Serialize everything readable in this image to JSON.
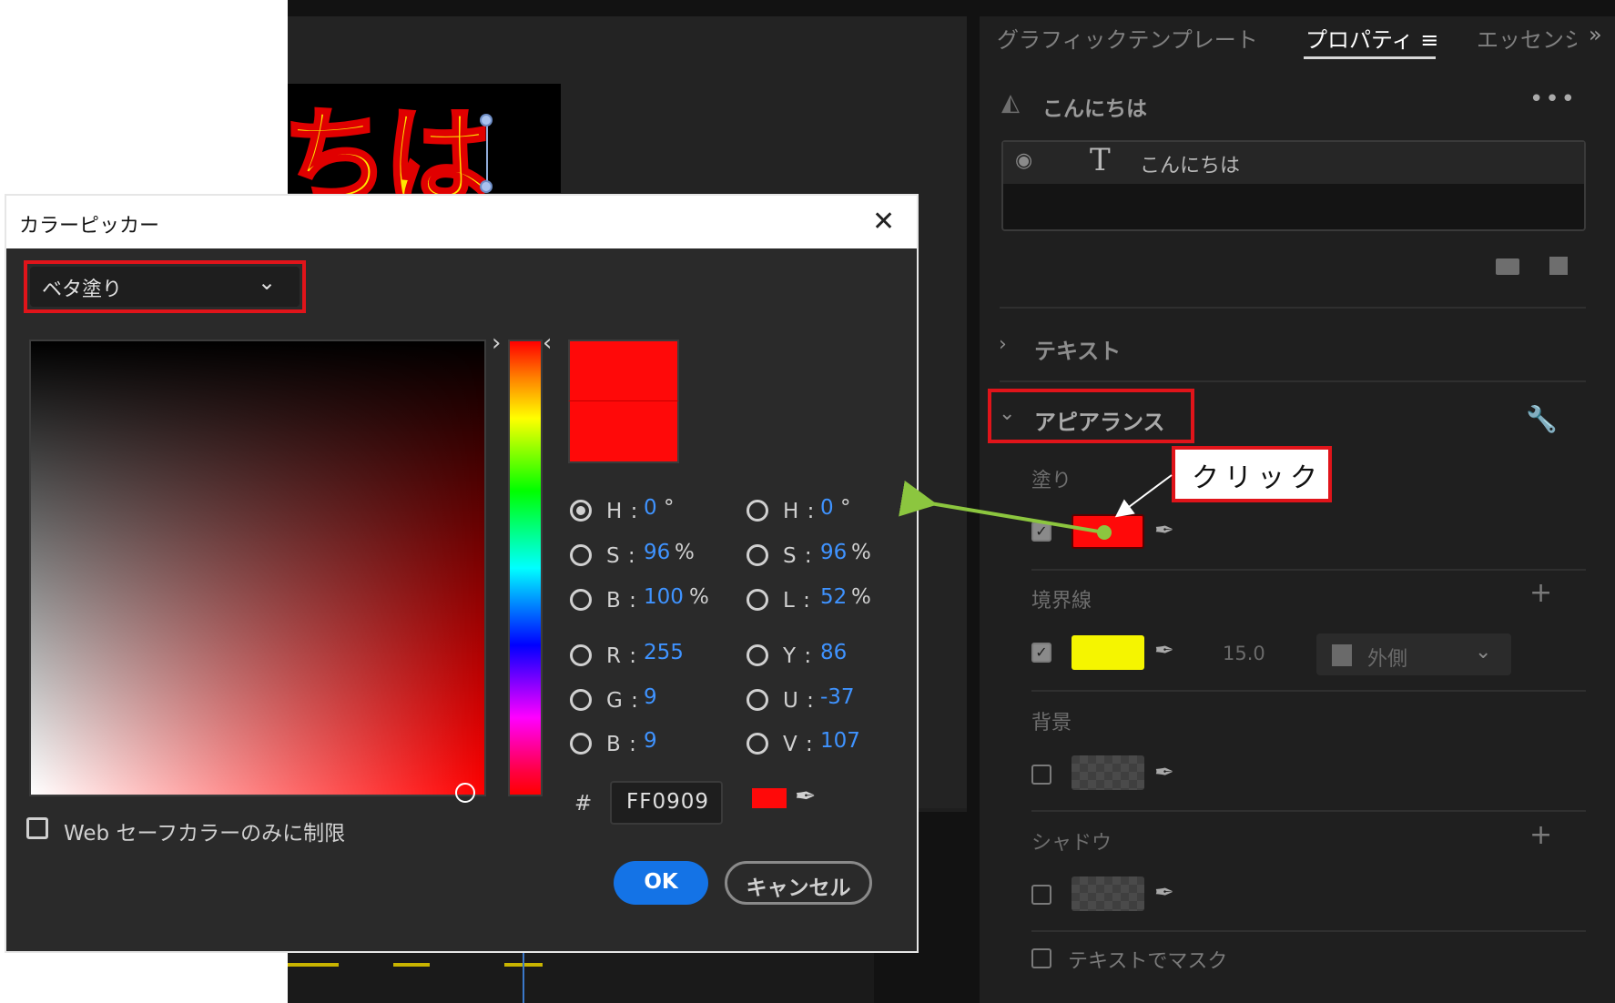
{
  "dialog": {
    "title": "カラーピッカー",
    "fill_type": "ベタ塗り",
    "hsb": {
      "h_label": "H :",
      "h_value": "0",
      "h_unit": "°",
      "s_label": "S :",
      "s_value": "96",
      "s_unit": "%",
      "b_label": "B :",
      "b_value": "100",
      "b_unit": "%"
    },
    "hsl": {
      "h_label": "H :",
      "h_value": "0",
      "h_unit": "°",
      "s_label": "S :",
      "s_value": "96",
      "s_unit": "%",
      "l_label": "L :",
      "l_value": "52",
      "l_unit": "%"
    },
    "rgb": {
      "r_label": "R :",
      "r_value": "255",
      "g_label": "G :",
      "g_value": "9",
      "b_label": "B :",
      "b_value": "9"
    },
    "yuv": {
      "y_label": "Y :",
      "y_value": "86",
      "u_label": "U :",
      "u_value": "-37",
      "v_label": "V :",
      "v_value": "107"
    },
    "hex_hash": "#",
    "hex_value": "FF0909",
    "websafe_label": "Web セーフカラーのみに制限",
    "ok_label": "OK",
    "cancel_label": "キャンセル",
    "selected_color": "#ff0909"
  },
  "panel": {
    "tabs": [
      "グラフィックテンプレート",
      "プロパティ",
      "エッセンシ"
    ],
    "tab_menu_icon": "≡",
    "tab_overflow": "»",
    "object_title": "こんにちは",
    "layer_label": "こんにちは",
    "layer_type_icon": "T",
    "section_text": "テキスト",
    "section_appearance": "アピアランス",
    "fill_label": "塗り",
    "fill_color": "#ff0909",
    "stroke_label": "境界線",
    "stroke_color": "#f5f500",
    "stroke_width": "15.0",
    "stroke_position": "外側",
    "background_label": "背景",
    "shadow_label": "シャドウ",
    "mask_label": "テキストでマスク"
  },
  "annotation": {
    "callout": "クリック",
    "highlight_color": "#e0141a",
    "arrow_color": "#8cc63f"
  },
  "preview": {
    "text": "ちは"
  }
}
